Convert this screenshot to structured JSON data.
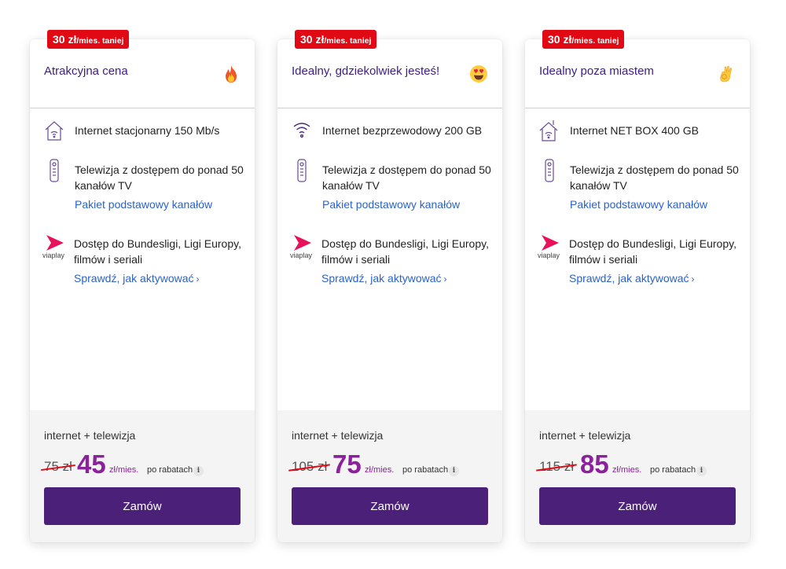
{
  "cards": [
    {
      "badge_amount": "30 zł",
      "badge_unit": "/mies. taniej",
      "title": "Atrakcyjna cena",
      "emoji_icon": "fire-emoji-icon",
      "internet": "Internet stacjonarny 150 Mb/s",
      "internet_icon": "house-wifi-icon",
      "tv": "Telewizja z dostępem do ponad 50 kanałów TV",
      "tv_link": "Pakiet podstawowy kanałów",
      "viaplay": "Dostęp do Bundesligi, Ligi Europy, filmów i seriali",
      "viaplay_link": "Sprawdź, jak aktywować",
      "plan": "internet + telewizja",
      "old_price": "75 zł",
      "new_price": "45",
      "per": "zł/mies.",
      "after": "po rabatach",
      "order": "Zamów"
    },
    {
      "badge_amount": "30 zł",
      "badge_unit": "/mies. taniej",
      "title": "Idealny, gdziekolwiek jesteś!",
      "emoji_icon": "heart-eyes-emoji-icon",
      "internet": "Internet bezprzewodowy 200 GB",
      "internet_icon": "wifi-icon",
      "tv": "Telewizja z dostępem do ponad 50 kanałów TV",
      "tv_link": "Pakiet podstawowy kanałów",
      "viaplay": "Dostęp do Bundesligi, Ligi Europy, filmów i seriali",
      "viaplay_link": "Sprawdź, jak aktywować",
      "plan": "internet + telewizja",
      "old_price": "105 zł",
      "new_price": "75",
      "per": "zł/mies.",
      "after": "po rabatach",
      "order": "Zamów"
    },
    {
      "badge_amount": "30 zł",
      "badge_unit": "/mies. taniej",
      "title": "Idealny poza miastem",
      "emoji_icon": "ok-hand-emoji-icon",
      "internet": "Internet NET BOX 400 GB",
      "internet_icon": "house-antenna-icon",
      "tv": "Telewizja z dostępem do ponad 50 kanałów TV",
      "tv_link": "Pakiet podstawowy kanałów",
      "viaplay": "Dostęp do Bundesligi, Ligi Europy, filmów i seriali",
      "viaplay_link": "Sprawdź, jak aktywować",
      "plan": "internet + telewizja",
      "old_price": "115 zł",
      "new_price": "85",
      "per": "zł/mies.",
      "after": "po rabatach",
      "order": "Zamów"
    }
  ],
  "viaplay_logo_text": "viaplay",
  "colors": {
    "badge": "#e00914",
    "title": "#3d1c87",
    "price": "#8a239b",
    "link": "#2b62c9",
    "button": "#4a2079"
  }
}
